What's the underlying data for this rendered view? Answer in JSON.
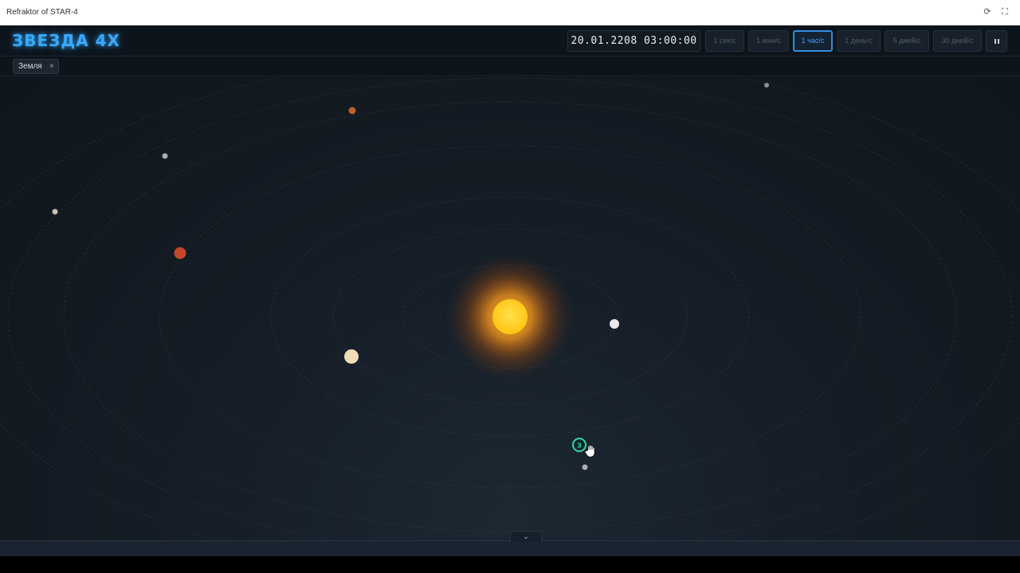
{
  "browser": {
    "title": "Refraktor of STAR-4",
    "refresh_icon": "refresh-icon",
    "fullscreen_icon": "fullscreen-icon"
  },
  "header": {
    "logo": "ЗВЕЗДА 4X",
    "datetime": "20.01.2208 03:00:00",
    "speeds": [
      "1 сек/с",
      "1 мин/с",
      "1 час/с",
      "1 день/с",
      "5 дней/с",
      "30 дней/с"
    ],
    "active_speed": "1 час/с",
    "pause_icon": "pause-icon"
  },
  "tabs": {
    "items": [
      {
        "label": "Земля",
        "close": "×"
      }
    ]
  },
  "map": {
    "marker_letter": "З",
    "colors": {
      "sun": "#ffd21c",
      "marker": "#33d6a8",
      "accent": "#39a9ff"
    }
  },
  "footer": {
    "collapse_icon": "chevron-down-icon",
    "collapse_glyph": "⌄"
  }
}
